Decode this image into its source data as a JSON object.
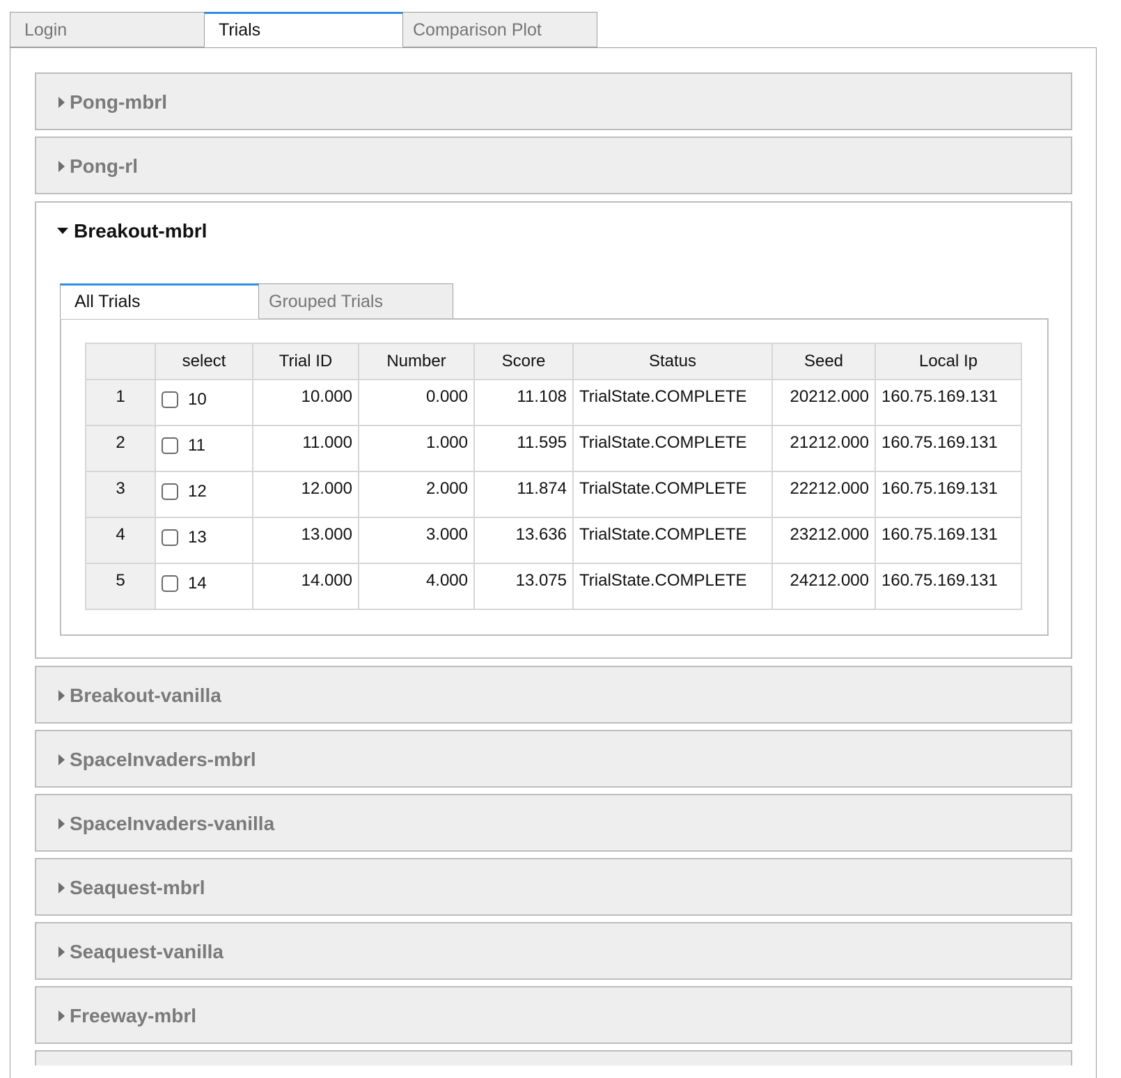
{
  "tabs": [
    "Login",
    "Trials",
    "Comparison Plot"
  ],
  "accordions_before": [
    "Pong-mbrl",
    "Pong-rl"
  ],
  "open_section": {
    "title": "Breakout-mbrl",
    "inner_tabs": [
      "All Trials",
      "Grouped Trials"
    ],
    "table": {
      "columns": [
        "select",
        "Trial ID",
        "Number",
        "Score",
        "Status",
        "Seed",
        "Local Ip"
      ],
      "rows": [
        {
          "index": "1",
          "select": "10",
          "trial_id": "10.000",
          "number": "0.000",
          "score": "11.108",
          "status": "TrialState.COMPLETE",
          "seed": "20212.000",
          "local_ip": "160.75.169.131"
        },
        {
          "index": "2",
          "select": "11",
          "trial_id": "11.000",
          "number": "1.000",
          "score": "11.595",
          "status": "TrialState.COMPLETE",
          "seed": "21212.000",
          "local_ip": "160.75.169.131"
        },
        {
          "index": "3",
          "select": "12",
          "trial_id": "12.000",
          "number": "2.000",
          "score": "11.874",
          "status": "TrialState.COMPLETE",
          "seed": "22212.000",
          "local_ip": "160.75.169.131"
        },
        {
          "index": "4",
          "select": "13",
          "trial_id": "13.000",
          "number": "3.000",
          "score": "13.636",
          "status": "TrialState.COMPLETE",
          "seed": "23212.000",
          "local_ip": "160.75.169.131"
        },
        {
          "index": "5",
          "select": "14",
          "trial_id": "14.000",
          "number": "4.000",
          "score": "13.075",
          "status": "TrialState.COMPLETE",
          "seed": "24212.000",
          "local_ip": "160.75.169.131"
        }
      ]
    }
  },
  "accordions_after": [
    "Breakout-vanilla",
    "SpaceInvaders-mbrl",
    "SpaceInvaders-vanilla",
    "Seaquest-mbrl",
    "Seaquest-vanilla",
    "Freeway-mbrl"
  ],
  "colors": {
    "accent": "#2f8ee0",
    "panel_bg": "#eeeeee",
    "border": "#bdbdbd"
  }
}
